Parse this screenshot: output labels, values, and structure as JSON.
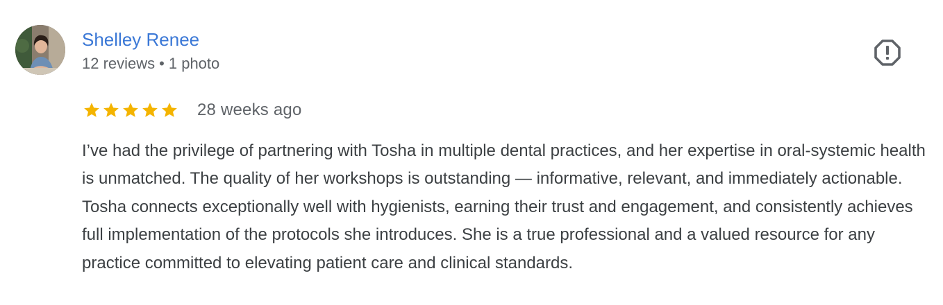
{
  "reviewer": {
    "name": "Shelley Renee",
    "reviews_count": "12 reviews",
    "separator": "•",
    "photos_count": "1 photo",
    "avatar_icon": "reviewer-avatar-photo"
  },
  "flag_icon": "report-flag-icon",
  "rating": {
    "stars": 5,
    "max": 5,
    "star_color": "#f4b400",
    "date": "28 weeks ago"
  },
  "review_text": "I’ve had the privilege of partnering with Tosha in multiple dental practices, and her expertise in oral-systemic health is unmatched. The quality of her workshops is outstanding — informative, relevant, and immediately actionable. Tosha connects exceptionally well with hygienists, earning their trust and engagement, and consistently achieves full implementation of the protocols she introduces. She is a true professional and a valued resource for any practice committed to elevating patient care and clinical standards.",
  "colors": {
    "name_link": "#3b78d6",
    "text": "#3c4043",
    "meta": "#5f6368"
  }
}
